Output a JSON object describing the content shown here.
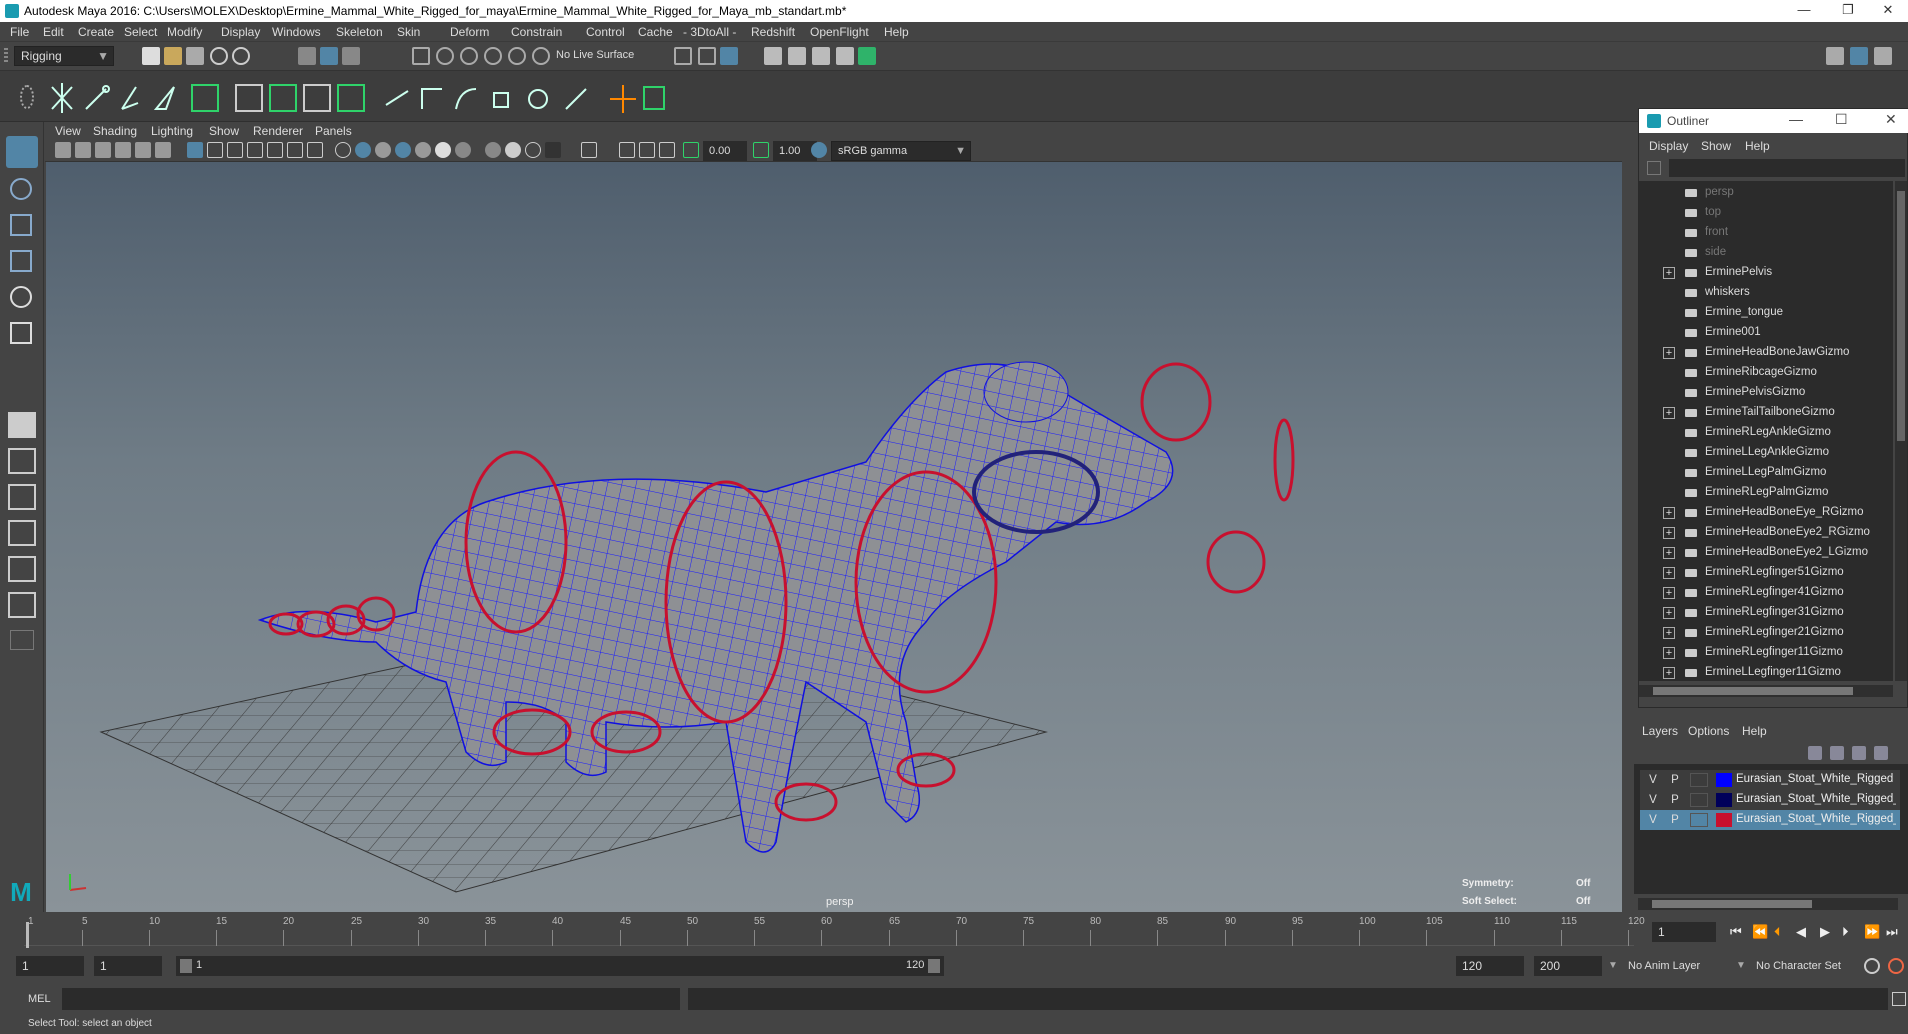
{
  "window": {
    "title": "Autodesk Maya 2016: C:\\Users\\MOLEX\\Desktop\\Ermine_Mammal_White_Rigged_for_maya\\Ermine_Mammal_White_Rigged_for_Maya_mb_standart.mb*",
    "minimize": "—",
    "restore": "❐",
    "close": "✕"
  },
  "menubar": [
    "File",
    "Edit",
    "Create",
    "Select",
    "Modify",
    "Display",
    "Windows",
    "Skeleton",
    "Skin",
    "Deform",
    "Constrain",
    "Control",
    "Cache",
    "- 3DtoAll -",
    "Redshift",
    "OpenFlight",
    "Help"
  ],
  "statusline": {
    "menuset": "Rigging",
    "live_surface": "No Live Surface"
  },
  "panel": {
    "menus": [
      "View",
      "Shading",
      "Lighting",
      "Show",
      "Renderer",
      "Panels"
    ],
    "exposure": "0.00",
    "gamma": "1.00",
    "colorspace": "sRGB gamma",
    "camera_label": "persp",
    "symmetry_label": "Symmetry:",
    "symmetry_value": "Off",
    "softselect_label": "Soft Select:",
    "softselect_value": "Off"
  },
  "outliner": {
    "title": "Outliner",
    "menus": [
      "Display",
      "Show",
      "Help"
    ],
    "items": [
      {
        "label": "persp",
        "expand": false,
        "dim": true
      },
      {
        "label": "top",
        "expand": false,
        "dim": true
      },
      {
        "label": "front",
        "expand": false,
        "dim": true
      },
      {
        "label": "side",
        "expand": false,
        "dim": true
      },
      {
        "label": "ErminePelvis",
        "expand": true,
        "dim": false
      },
      {
        "label": "whiskers",
        "expand": false,
        "dim": false
      },
      {
        "label": "Ermine_tongue",
        "expand": false,
        "dim": false
      },
      {
        "label": "Ermine001",
        "expand": false,
        "dim": false
      },
      {
        "label": "ErmineHeadBoneJawGizmo",
        "expand": true,
        "dim": false
      },
      {
        "label": "ErmineRibcageGizmo",
        "expand": false,
        "dim": false
      },
      {
        "label": "ErminePelvisGizmo",
        "expand": false,
        "dim": false
      },
      {
        "label": "ErmineTailTailboneGizmo",
        "expand": true,
        "dim": false
      },
      {
        "label": "ErmineRLegAnkleGizmo",
        "expand": false,
        "dim": false
      },
      {
        "label": "ErmineLLegAnkleGizmo",
        "expand": false,
        "dim": false
      },
      {
        "label": "ErmineLLegPalmGizmo",
        "expand": false,
        "dim": false
      },
      {
        "label": "ErmineRLegPalmGizmo",
        "expand": false,
        "dim": false
      },
      {
        "label": "ErmineHeadBoneEye_RGizmo",
        "expand": true,
        "dim": false
      },
      {
        "label": "ErmineHeadBoneEye2_RGizmo",
        "expand": true,
        "dim": false
      },
      {
        "label": "ErmineHeadBoneEye2_LGizmo",
        "expand": true,
        "dim": false
      },
      {
        "label": "ErmineRLegfinger51Gizmo",
        "expand": true,
        "dim": false
      },
      {
        "label": "ErmineRLegfinger41Gizmo",
        "expand": true,
        "dim": false
      },
      {
        "label": "ErmineRLegfinger31Gizmo",
        "expand": true,
        "dim": false
      },
      {
        "label": "ErmineRLegfinger21Gizmo",
        "expand": true,
        "dim": false
      },
      {
        "label": "ErmineRLegfinger11Gizmo",
        "expand": true,
        "dim": false
      },
      {
        "label": "ErmineLLegfinger11Gizmo",
        "expand": true,
        "dim": false
      }
    ]
  },
  "layers": {
    "menus": [
      "Layers",
      "Options",
      "Help"
    ],
    "rows": [
      {
        "v": "V",
        "p": "P",
        "color": "#0000ff",
        "name": "Eurasian_Stoat_White_Rigged",
        "selected": false
      },
      {
        "v": "V",
        "p": "P",
        "color": "#00005a",
        "name": "Eurasian_Stoat_White_Rigged_B",
        "selected": false
      },
      {
        "v": "V",
        "p": "P",
        "color": "#c8102e",
        "name": "Eurasian_Stoat_White_Rigged_C",
        "selected": true
      }
    ]
  },
  "timeline": {
    "ticks": [
      "1",
      "5",
      "10",
      "15",
      "20",
      "25",
      "30",
      "35",
      "40",
      "45",
      "50",
      "55",
      "60",
      "65",
      "70",
      "75",
      "80",
      "85",
      "90",
      "95",
      "100",
      "105",
      "110",
      "115",
      "120"
    ],
    "current_frame": "1"
  },
  "range": {
    "start": "1",
    "inner_start": "1",
    "slider_start": "1",
    "slider_end": "120",
    "end": "120",
    "outer_end": "200",
    "anim_layer": "No Anim Layer",
    "character_set": "No Character Set"
  },
  "cmd": {
    "lang": "MEL"
  },
  "help": {
    "text": "Select Tool: select an object"
  },
  "colors": {
    "wire": "#1a1aff",
    "control": "#c8102e",
    "accent": "#5285a6"
  }
}
